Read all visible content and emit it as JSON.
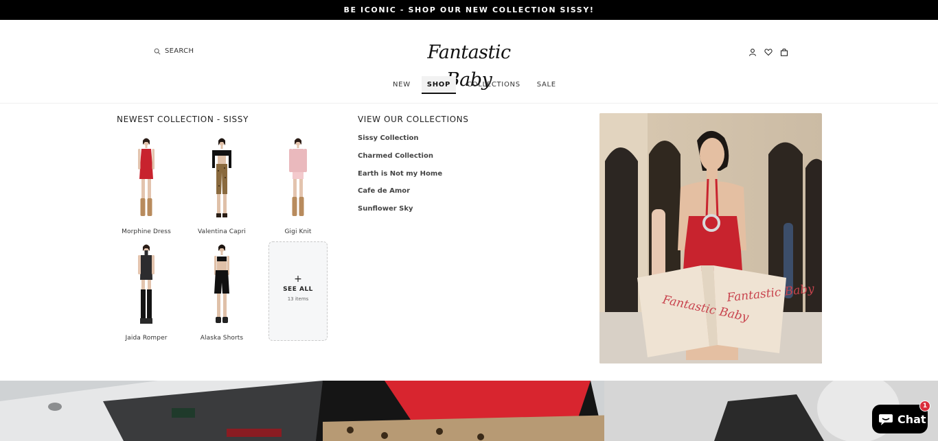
{
  "announcement": "BE ICONIC - SHOP OUR NEW COLLECTION SISSY!",
  "header": {
    "search_label": "SEARCH",
    "logo_text": "Fantastic Baby",
    "icons": [
      "account-icon",
      "wishlist-heart-icon",
      "cart-bag-icon"
    ]
  },
  "nav": {
    "items": [
      "NEW",
      "SHOP",
      "COLLECTIONS",
      "SALE"
    ],
    "active": "SHOP"
  },
  "mega_menu": {
    "newest_title": "NEWEST COLLECTION - SISSY",
    "products": [
      {
        "name": "Morphine Dress"
      },
      {
        "name": "Valentina Capri"
      },
      {
        "name": "Gigi Knit"
      },
      {
        "name": "Jaida Romper"
      },
      {
        "name": "Alaska Shorts"
      }
    ],
    "see_all": {
      "icon": "+",
      "label": "SEE ALL",
      "count": "13 items"
    },
    "collections_title": "VIEW OUR COLLECTIONS",
    "collections": [
      "Sissy Collection",
      "Charmed Collection",
      "Earth is Not my Home",
      "Cafe de Amor",
      "Sunflower Sky"
    ],
    "promo_bag_text": "Fantastic Baby"
  },
  "chat": {
    "label": "Chat",
    "badge": "1"
  },
  "colors": {
    "accent_red": "#c8232e",
    "announce_bg": "#000000",
    "chat_bg": "#000000",
    "badge_red": "#d92d3b"
  }
}
